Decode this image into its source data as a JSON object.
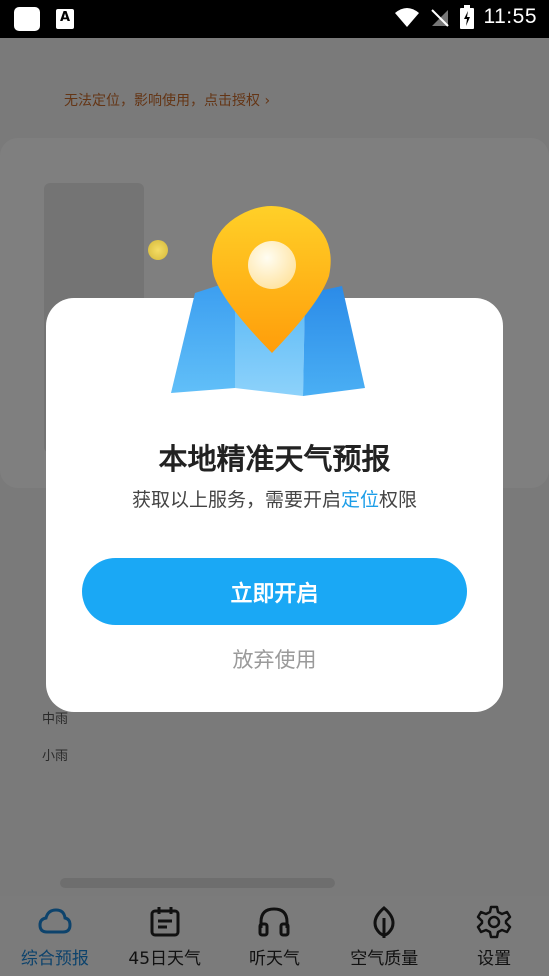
{
  "status_bar": {
    "time": "11:55",
    "app_icon_letter": "A"
  },
  "background": {
    "location_hint": "无法定位，影响使用，点击授权 ›",
    "rain_label_1": "中雨",
    "rain_label_2": "小雨"
  },
  "dialog": {
    "title": "本地精准天气预报",
    "subtitle_before": "获取以上服务，需要开启",
    "subtitle_highlight": "定位",
    "subtitle_after": "权限",
    "enable_button": "立即开启",
    "abandon_button": "放弃使用"
  },
  "bottom_nav": {
    "items": [
      {
        "label": "综合预报",
        "icon": "cloud-icon",
        "active": true
      },
      {
        "label": "45日天气",
        "icon": "calendar-icon",
        "active": false
      },
      {
        "label": "听天气",
        "icon": "headphones-icon",
        "active": false
      },
      {
        "label": "空气质量",
        "icon": "leaf-icon",
        "active": false
      },
      {
        "label": "设置",
        "icon": "gear-icon",
        "active": false
      }
    ]
  },
  "colors": {
    "accent": "#1aa8f5",
    "highlight": "#1d9ee8",
    "active_nav": "#1a86d9",
    "hint": "#c96a2a"
  }
}
